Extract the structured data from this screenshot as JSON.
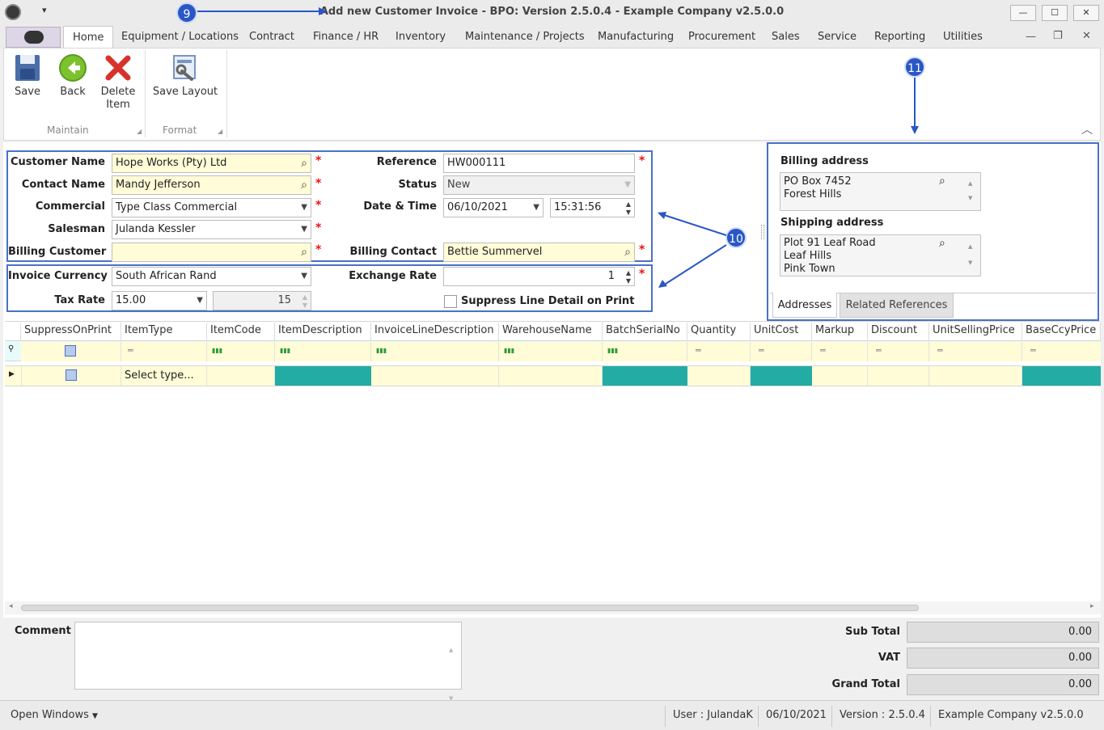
{
  "window": {
    "title": "Add new Customer Invoice - BPO: Version 2.5.0.4 - Example Company v2.5.0.0"
  },
  "tabs": [
    "Home",
    "Equipment / Locations",
    "Contract",
    "Finance / HR",
    "Inventory",
    "Maintenance / Projects",
    "Manufacturing",
    "Procurement",
    "Sales",
    "Service",
    "Reporting",
    "Utilities"
  ],
  "ribbon": {
    "save": "Save",
    "back": "Back",
    "delete_line1": "Delete",
    "delete_line2": "Item",
    "save_layout": "Save Layout",
    "group_maintain": "Maintain",
    "group_format": "Format"
  },
  "callouts": {
    "c9": "9",
    "c10": "10",
    "c11": "11"
  },
  "form": {
    "customer_name_label": "Customer Name",
    "customer_name": "Hope Works (Pty) Ltd",
    "contact_name_label": "Contact Name",
    "contact_name": "Mandy Jefferson",
    "commercial_label": "Commercial",
    "commercial": "Type Class Commercial",
    "salesman_label": "Salesman",
    "salesman": "Julanda Kessler",
    "billing_customer_label": "Billing Customer",
    "billing_customer": "",
    "reference_label": "Reference",
    "reference": "HW000111",
    "status_label": "Status",
    "status": "New",
    "datetime_label": "Date & Time",
    "date": "06/10/2021",
    "time": "15:31:56",
    "billing_contact_label": "Billing Contact",
    "billing_contact": "Bettie Summervel",
    "invoice_currency_label": "Invoice Currency",
    "invoice_currency": "South African Rand",
    "tax_rate_label": "Tax Rate",
    "tax_rate": "15.00",
    "tax_rate_value": "15",
    "exchange_rate_label": "Exchange Rate",
    "exchange_rate": "1",
    "suppress_label": "Suppress Line Detail on Print"
  },
  "addresses": {
    "billing_title": "Billing address",
    "billing_line1": "PO Box 7452",
    "billing_line2": "Forest Hills",
    "shipping_title": "Shipping address",
    "shipping_line1": "Plot 91 Leaf Road",
    "shipping_line2": "Leaf Hills",
    "shipping_line3": "Pink Town",
    "tab_addresses": "Addresses",
    "tab_related": "Related References"
  },
  "grid": {
    "columns": [
      "SuppressOnPrint",
      "ItemType",
      "ItemCode",
      "ItemDescription",
      "InvoiceLineDescription",
      "WarehouseName",
      "BatchSerialNo",
      "Quantity",
      "UnitCost",
      "Markup",
      "Discount",
      "UnitSellingPrice",
      "BaseCcyPrice"
    ],
    "select_type": "Select type..."
  },
  "footer": {
    "comment_label": "Comment",
    "subtotal_label": "Sub Total",
    "subtotal": "0.00",
    "vat_label": "VAT",
    "vat": "0.00",
    "grand_total_label": "Grand Total",
    "grand_total": "0.00"
  },
  "status": {
    "open_windows": "Open Windows",
    "user": "User : JulandaK",
    "date": "06/10/2021",
    "version": "Version : 2.5.0.4",
    "company": "Example Company v2.5.0.0"
  },
  "colors": {
    "accent": "#4a71c7",
    "badge": "#2a56c6",
    "teal": "#22aca4",
    "required_yellow": "#fffcd7"
  }
}
